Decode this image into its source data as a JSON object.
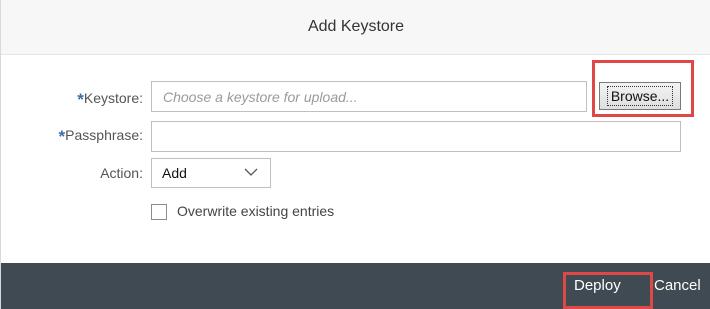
{
  "dialog": {
    "title": "Add Keystore"
  },
  "form": {
    "keystore": {
      "required_marker": "*",
      "label": "Keystore:",
      "placeholder": "Choose a keystore for upload...",
      "value": "",
      "browse_label": "Browse..."
    },
    "passphrase": {
      "required_marker": "*",
      "label": "Passphrase:",
      "value": ""
    },
    "action": {
      "label": "Action:",
      "selected": "Add",
      "icon": "chevron-down-icon"
    },
    "overwrite": {
      "label": "Overwrite existing entries",
      "checked": false
    }
  },
  "footer": {
    "deploy_label": "Deploy",
    "cancel_label": "Cancel"
  },
  "colors": {
    "footer_bg": "#3f4a52",
    "highlight": "#e04848",
    "required": "#3a6ea5"
  }
}
